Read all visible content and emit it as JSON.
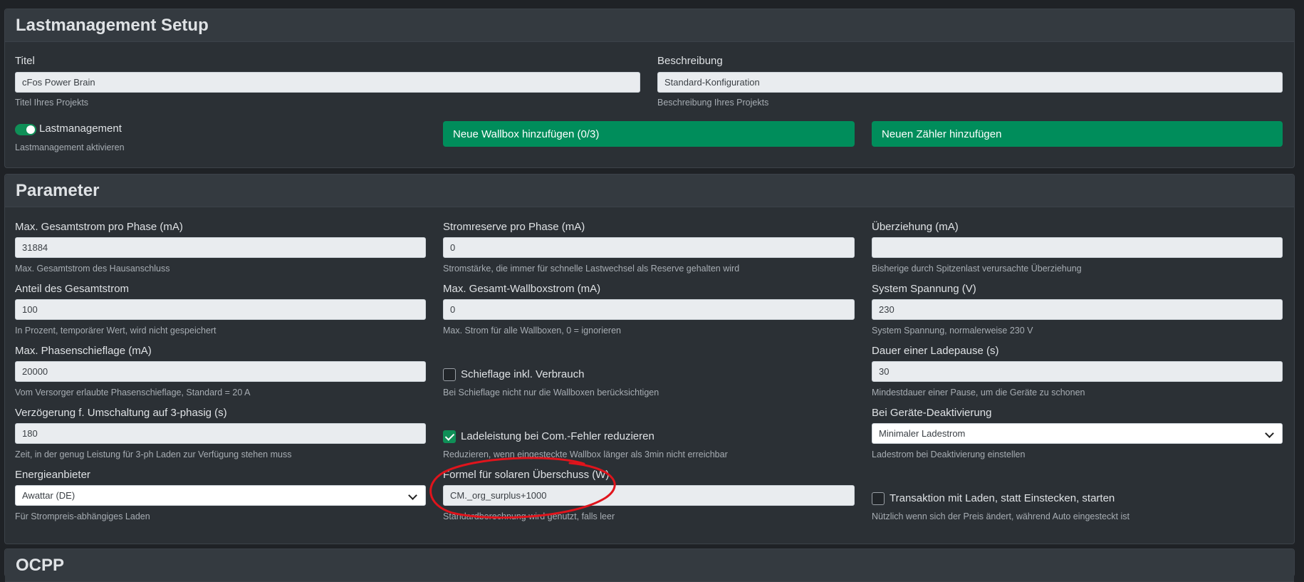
{
  "setup": {
    "title": "Lastmanagement Setup",
    "titel_label": "Titel",
    "titel_value": "cFos Power Brain",
    "titel_help": "Titel Ihres Projekts",
    "beschreibung_label": "Beschreibung",
    "beschreibung_value": "Standard-Konfiguration",
    "beschreibung_help": "Beschreibung Ihres Projekts",
    "lastmanagement_label": "Lastmanagement",
    "lastmanagement_enabled": true,
    "lastmanagement_help": "Lastmanagement aktivieren",
    "add_wallbox_label": "Neue Wallbox hinzufügen (0/3)",
    "add_meter_label": "Neuen Zähler hinzufügen"
  },
  "parameter": {
    "title": "Parameter",
    "max_gesamtstrom": {
      "label": "Max. Gesamtstrom pro Phase (mA)",
      "value": "31884",
      "help": "Max. Gesamtstrom des Hausanschluss"
    },
    "stromreserve": {
      "label": "Stromreserve pro Phase (mA)",
      "value": "0",
      "help": "Stromstärke, die immer für schnelle Lastwechsel als Reserve gehalten wird"
    },
    "ueberziehung": {
      "label": "Überziehung (mA)",
      "value": "",
      "help": "Bisherige durch Spitzenlast verursachte Überziehung"
    },
    "anteil": {
      "label": "Anteil des Gesamtstrom",
      "value": "100",
      "help": "In Prozent, temporärer Wert, wird nicht gespeichert"
    },
    "max_wallboxstrom": {
      "label": "Max. Gesamt-Wallboxstrom (mA)",
      "value": "0",
      "help": "Max. Strom für alle Wallboxen, 0 = ignorieren"
    },
    "system_spannung": {
      "label": "System Spannung (V)",
      "value": "230",
      "help": "System Spannung, normalerweise 230 V"
    },
    "phasenschieflage": {
      "label": "Max. Phasenschieflage (mA)",
      "value": "20000",
      "help": "Vom Versorger erlaubte Phasenschieflage, Standard = 20 A"
    },
    "schieflage_verbrauch": {
      "label": "Schieflage inkl. Verbrauch",
      "checked": false,
      "help": "Bei Schieflage nicht nur die Wallboxen berücksichtigen"
    },
    "ladepause": {
      "label": "Dauer einer Ladepause (s)",
      "value": "30",
      "help": "Mindestdauer einer Pause, um die Geräte zu schonen"
    },
    "verzoegerung": {
      "label": "Verzögerung f. Umschaltung auf 3-phasig (s)",
      "value": "180",
      "help": "Zeit, in der genug Leistung für 3-ph Laden zur Verfügung stehen muss"
    },
    "ladeleistung_reduzieren": {
      "label": "Ladeleistung bei Com.-Fehler reduzieren",
      "checked": true,
      "help": "Reduzieren, wenn eingesteckte Wallbox länger als 3min nicht erreichbar"
    },
    "geraete_deaktivierung": {
      "label": "Bei Geräte-Deaktivierung",
      "value": "Minimaler Ladestrom",
      "help": "Ladestrom bei Deaktivierung einstellen"
    },
    "energieanbieter": {
      "label": "Energieanbieter",
      "value": "Awattar (DE)",
      "help": "Für Strompreis-abhängiges Laden"
    },
    "solar_formel": {
      "label": "Formel für solaren Überschuss (W)",
      "value": "CM._org_surplus+1000",
      "help": "Standardberechnung wird genutzt, falls leer"
    },
    "transaktion": {
      "label": "Transaktion mit Laden, statt Einstecken, starten",
      "checked": false,
      "help": "Nützlich wenn sich der Preis ändert, während Auto eingesteckt ist"
    }
  },
  "ocpp": {
    "title": "OCPP"
  },
  "colors": {
    "accent": "#008d5b",
    "annotation": "#e0141c",
    "background": "#1f2226"
  }
}
